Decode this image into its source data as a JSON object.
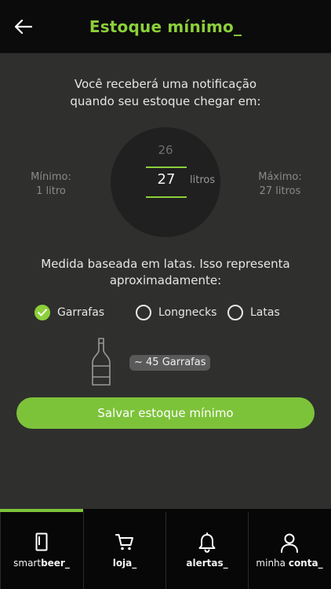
{
  "header": {
    "title": "Estoque mínimo_",
    "back_icon": "arrow-left-icon"
  },
  "intro": {
    "line1": "Você receberá uma notificação",
    "line2": "quando seu estoque chegar em:"
  },
  "dial": {
    "previous_value": "26",
    "current_value": "27",
    "unit": "litros"
  },
  "range": {
    "min_label": "Mínimo:",
    "min_value": "1 litro",
    "max_label": "Máximo:",
    "max_value": "27 litros"
  },
  "measure": {
    "line1": "Medida baseada em latas.  Isso representa",
    "line2": "aproximadamente:"
  },
  "options": [
    {
      "label": "Garrafas",
      "selected": true
    },
    {
      "label": "Longnecks",
      "selected": false
    },
    {
      "label": "Latas",
      "selected": false
    }
  ],
  "estimate": {
    "icon": "bottle-icon",
    "text": "~ 45 Garrafas"
  },
  "save_button": {
    "label": "Salvar estoque mínimo"
  },
  "tabs": [
    {
      "icon": "fridge-icon",
      "prefix": "smart",
      "bold": "beer_",
      "active": true
    },
    {
      "icon": "cart-icon",
      "prefix": "",
      "bold": "loja_",
      "active": false
    },
    {
      "icon": "bell-icon",
      "prefix": "",
      "bold": "alertas_",
      "active": false
    },
    {
      "icon": "user-icon",
      "prefix": "minha ",
      "bold": "conta_",
      "active": false
    }
  ],
  "colors": {
    "accent": "#8ccf3a",
    "button": "#7dc33a",
    "background": "#2f2f2d",
    "header": "#0b0b0b"
  }
}
